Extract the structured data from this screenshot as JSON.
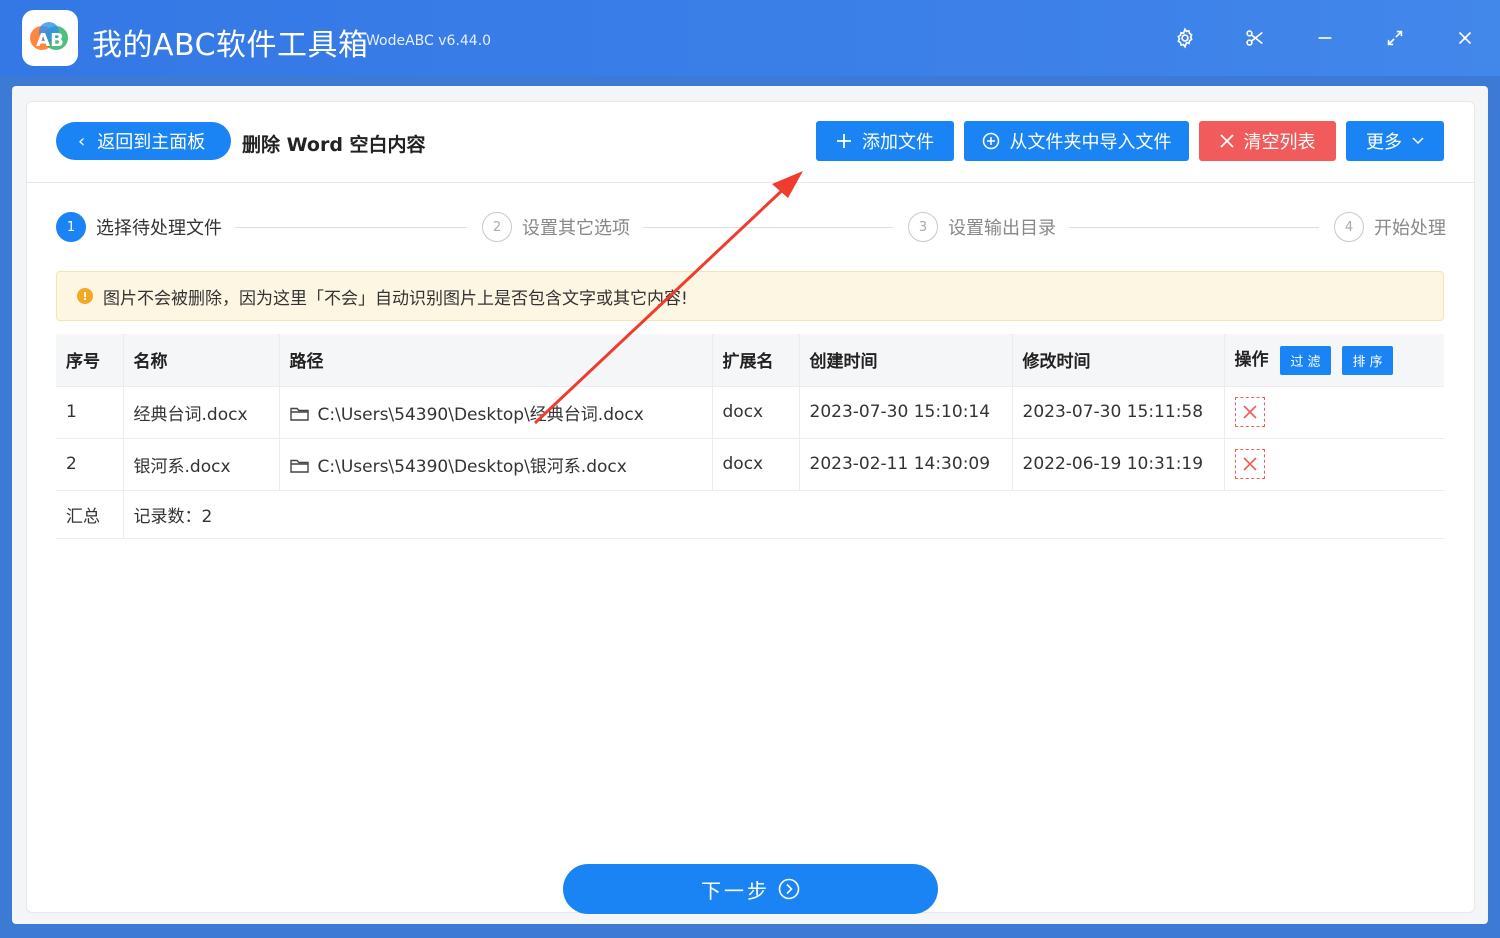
{
  "app": {
    "title": "我的ABC软件工具箱",
    "version": "WodeABC v6.44.0",
    "logo_text": "AB"
  },
  "toolbar": {
    "back_label": "返回到主面板",
    "page_title": "删除 Word 空白内容",
    "add_file_label": "添加文件",
    "import_folder_label": "从文件夹中导入文件",
    "clear_list_label": "清空列表",
    "more_label": "更多"
  },
  "steps": [
    {
      "num": "1",
      "label": "选择待处理文件"
    },
    {
      "num": "2",
      "label": "设置其它选项"
    },
    {
      "num": "3",
      "label": "设置输出目录"
    },
    {
      "num": "4",
      "label": "开始处理"
    }
  ],
  "notice": "图片不会被删除，因为这里「不会」自动识别图片上是否包含文字或其它内容!",
  "table": {
    "headers": {
      "index": "序号",
      "name": "名称",
      "path": "路径",
      "ext": "扩展名",
      "created": "创建时间",
      "modified": "修改时间",
      "action": "操作"
    },
    "filter_label": "过 滤",
    "sort_label": "排 序",
    "rows": [
      {
        "index": "1",
        "name": "经典台词.docx",
        "path": "C:\\Users\\54390\\Desktop\\经典台词.docx",
        "ext": "docx",
        "created": "2023-07-30 15:10:14",
        "modified": "2023-07-30 15:11:58"
      },
      {
        "index": "2",
        "name": "银河系.docx",
        "path": "C:\\Users\\54390\\Desktop\\银河系.docx",
        "ext": "docx",
        "created": "2023-02-11 14:30:09",
        "modified": "2022-06-19 10:31:19"
      }
    ],
    "summary_label": "汇总",
    "summary_value": "记录数：2"
  },
  "next_label": "下一步",
  "colors": {
    "accent": "#1a84f4",
    "danger": "#f15b5b",
    "titlebar": "#3478e6",
    "annotation_arrow": "#f03c2e"
  },
  "icons": [
    "gear-icon",
    "scissors-icon",
    "minimize-icon",
    "maximize-icon",
    "close-icon",
    "plus-icon",
    "plus-circle-icon",
    "x-icon",
    "chevron-down-icon",
    "warning-icon",
    "folder-icon",
    "delete-icon",
    "arrow-right-circle-icon"
  ]
}
